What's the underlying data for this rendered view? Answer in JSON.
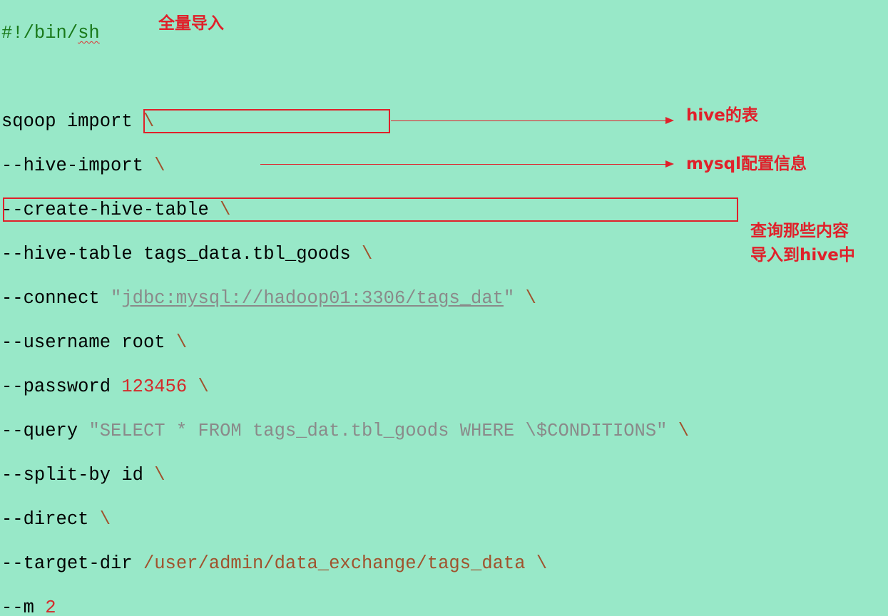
{
  "script": {
    "shebang_prefix": "#!/bin/",
    "shebang_sh": "sh",
    "command": "sqoop import",
    "bs": "\\",
    "hive_import": "--hive-import",
    "create_hive_table": "--create-hive-table",
    "hive_table_flag": "--hive-table",
    "hive_table_value": "tags_data.tbl_goods",
    "connect_flag": "--connect",
    "connect_q1": "\"",
    "connect_jdbc": "jdbc",
    "connect_colon": ":",
    "connect_mysql": "mysql",
    "connect_rest": "://hadoop01:3306/tags_dat",
    "connect_q2": "\"",
    "username_flag": "--username",
    "username_value": "root",
    "password_flag": "--password",
    "password_value": "123456",
    "query_flag": "--query",
    "query_value": "\"SELECT * FROM tags_dat.tbl_goods WHERE \\$CONDITIONS\"",
    "split_by_flag": "--split-by",
    "split_by_value": "id",
    "direct_flag": "--direct",
    "target_dir_flag": "--target-dir",
    "target_dir_value": "/user/admin/data_exchange/tags_data",
    "m_flag": "--m",
    "m_value": "2"
  },
  "annotations": {
    "full_import": "全量导入",
    "hive_table": "hive的表",
    "mysql_config": "mysql配置信息",
    "query_line1": "查询那些内容",
    "query_line2": "导入到hive中"
  },
  "colors": {
    "background": "#98e8c8",
    "annotation": "#e0202a",
    "shebang": "#19791a",
    "backslash": "#a0522d",
    "string": "#8a8a8a",
    "number": "#d42a2a"
  }
}
